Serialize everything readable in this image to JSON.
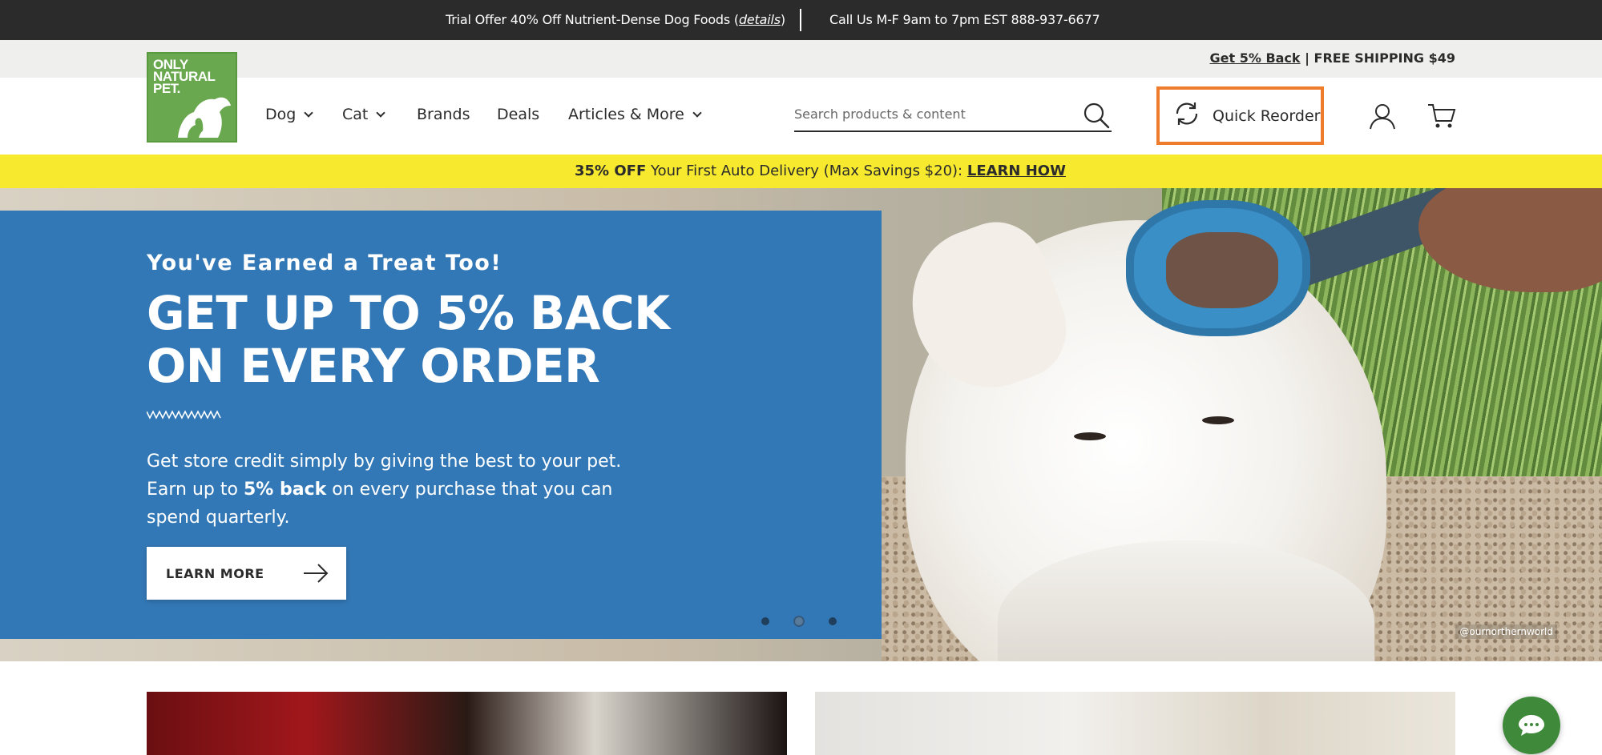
{
  "topbar": {
    "offer_prefix": "Trial Offer 40% Off Nutrient-Dense Dog Foods (",
    "offer_link": "details",
    "offer_suffix": ")",
    "call": "Call Us M-F 9am to 7pm EST 888-937-6677"
  },
  "promostrip": {
    "link": "Get 5% Back",
    "text": " | FREE SHIPPING $49"
  },
  "logo": {
    "line1": "ONLY",
    "line2": "NATURAL",
    "line3": "PET.",
    "color": "#6aa84f"
  },
  "nav": {
    "items": [
      {
        "label": "Dog",
        "has_dropdown": true
      },
      {
        "label": "Cat",
        "has_dropdown": true
      },
      {
        "label": "Brands",
        "has_dropdown": false
      },
      {
        "label": "Deals",
        "has_dropdown": false
      },
      {
        "label": "Articles & More",
        "has_dropdown": true
      }
    ]
  },
  "search": {
    "placeholder": "Search products & content",
    "value": ""
  },
  "quick_reorder": {
    "label": "Quick Reorder",
    "border_color": "#ef7b2d"
  },
  "icons": {
    "account": "user-icon",
    "cart": "cart-icon",
    "search": "search-icon",
    "reorder": "refresh-icon",
    "chat": "chat-icon"
  },
  "yellow_banner": {
    "bold": "35% OFF",
    "text": " Your First Auto Delivery (Max Savings $20): ",
    "link": "LEARN HOW",
    "bg": "#f7e92e"
  },
  "hero": {
    "eyebrow": "You've Earned a Treat Too!",
    "headline_line1": "GET UP TO 5% BACK",
    "headline_line2": "ON EVERY ORDER",
    "body_part1": "Get store credit simply by giving the best to your pet. Earn up to ",
    "body_bold": "5% back",
    "body_part2": " on every purchase that you can spend quarterly.",
    "cta": "LEARN MORE",
    "credit": "@ournorthernworld",
    "panel_color": "#3378b6",
    "slides": 3,
    "active_slide": 2
  }
}
